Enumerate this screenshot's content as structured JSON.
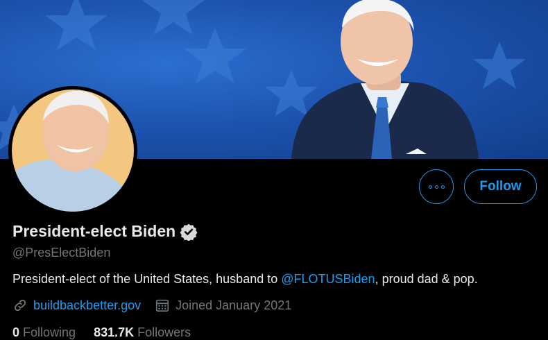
{
  "profile": {
    "name": "President-elect Biden",
    "handle": "@PresElectBiden",
    "bio_prefix": "President-elect of the United States, husband to ",
    "bio_mention": "@FLOTUSBiden",
    "bio_suffix": ", proud dad & pop.",
    "website": "buildbackbetter.gov",
    "joined": "Joined January 2021",
    "following_count": "0",
    "following_label": "Following",
    "followers_count": "831.7K",
    "followers_label": "Followers"
  },
  "actions": {
    "more_icon": "more-horizontal-icon",
    "follow_label": "Follow"
  },
  "icons": {
    "verified": "verified-badge-icon",
    "link": "link-icon",
    "calendar": "calendar-icon"
  },
  "colors": {
    "background": "#000000",
    "accent": "#1d9bf0",
    "text_primary": "#e7e9ea",
    "text_secondary": "#71767b",
    "banner_blue": "#1d54b0"
  }
}
